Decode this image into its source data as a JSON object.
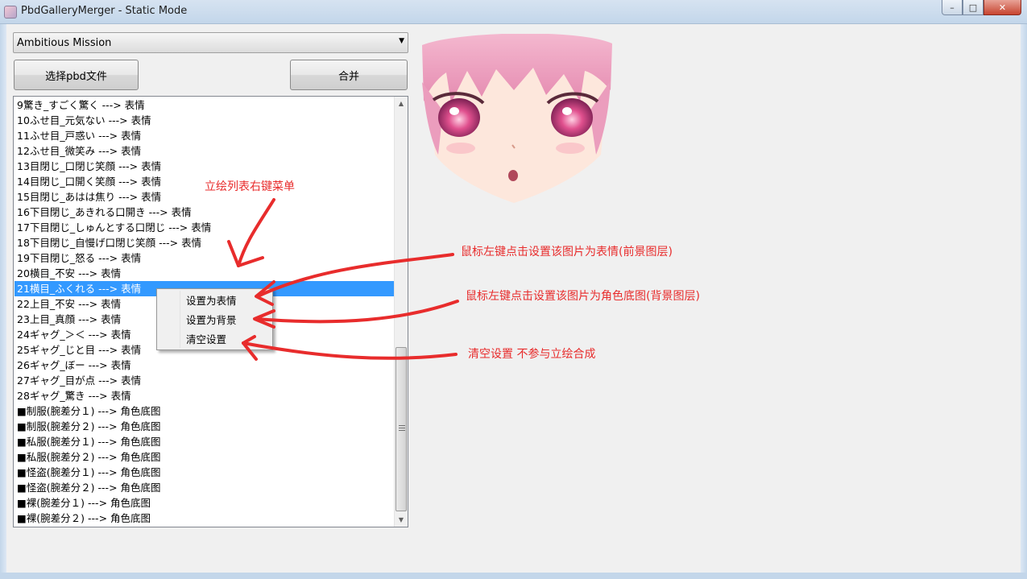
{
  "window": {
    "title": "PbdGalleryMerger - Static Mode",
    "controls": {
      "minimize": "–",
      "maximize": "□",
      "close": "✕"
    }
  },
  "character_select": {
    "selected": "Ambitious Mission"
  },
  "buttons": {
    "select_pbd": "选择pbd文件",
    "merge": "合并"
  },
  "list": {
    "selected_index": 12,
    "items": [
      "9驚き_すごく驚く ---> 表情",
      "10ふせ目_元気ない ---> 表情",
      "11ふせ目_戸惑い ---> 表情",
      "12ふせ目_微笑み ---> 表情",
      "13目閉じ_口閉じ笑顔 ---> 表情",
      "14目閉じ_口開く笑顔 ---> 表情",
      "15目閉じ_あはは焦り ---> 表情",
      "16下目閉じ_あきれる口開き ---> 表情",
      "17下目閉じ_しゅんとする口閉じ ---> 表情",
      "18下目閉じ_自慢げ口閉じ笑顔 ---> 表情",
      "19下目閉じ_怒る ---> 表情",
      "20横目_不安 ---> 表情",
      "21横目_ふくれる ---> 表情",
      "22上目_不安 ---> 表情",
      "23上目_真顔 ---> 表情",
      "24ギャグ_＞＜ ---> 表情",
      "25ギャグ_じと目 ---> 表情",
      "26ギャグ_ぼー ---> 表情",
      "27ギャグ_目が点 ---> 表情",
      "28ギャグ_驚き ---> 表情",
      "■制服(腕差分１) ---> 角色底图",
      "■制服(腕差分２) ---> 角色底图",
      "■私服(腕差分１) ---> 角色底图",
      "■私服(腕差分２) ---> 角色底图",
      "■怪盗(腕差分１) ---> 角色底图",
      "■怪盗(腕差分２) ---> 角色底图",
      "■裸(腕差分１) ---> 角色底图",
      "■裸(腕差分２) ---> 角色底图"
    ]
  },
  "context_menu": {
    "items": [
      "设置为表情",
      "设置为背景",
      "清空设置"
    ]
  },
  "annotations": {
    "list_menu": "立绘列表右键菜单",
    "set_expression": "鼠标左键点击设置该图片为表情(前景图层)",
    "set_background": "鼠标左键点击设置该图片为角色底图(背景图层)",
    "clear": "清空设置 不参与立绘合成",
    "color": "#e82c2c"
  },
  "icons": {
    "dropdown": "chevron-down-icon",
    "scroll_up": "scroll-up-arrow-icon",
    "scroll_down": "scroll-down-arrow-icon",
    "app": "app-icon"
  },
  "colors": {
    "selection": "#3399ff",
    "annotation": "#e82c2c"
  }
}
